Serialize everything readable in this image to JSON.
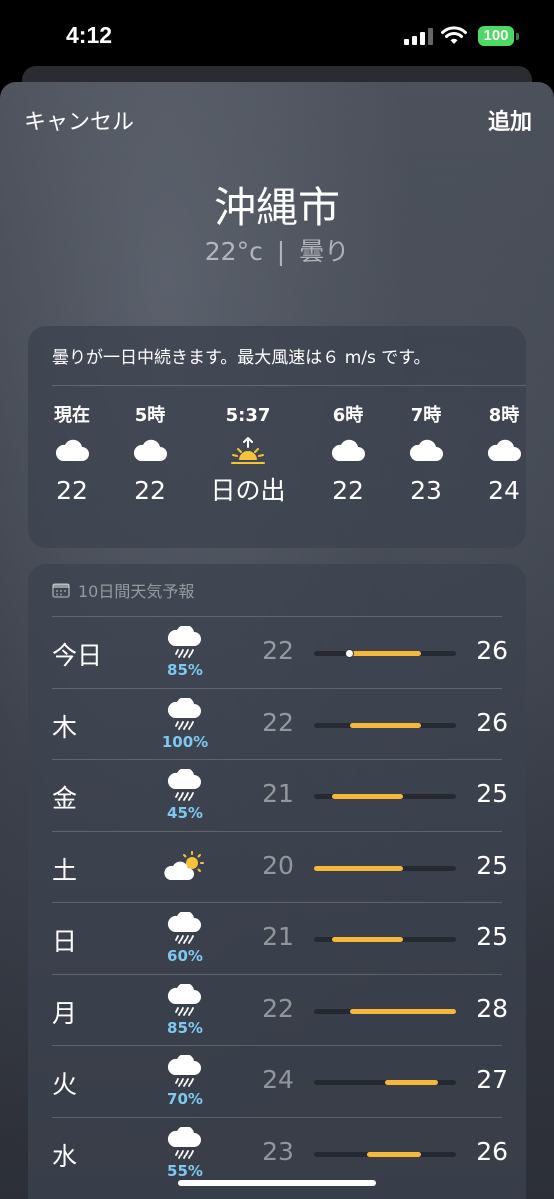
{
  "status": {
    "time": "4:12",
    "battery": "100"
  },
  "nav": {
    "cancel": "キャンセル",
    "add": "追加"
  },
  "location": {
    "city": "沖縄市",
    "temp": "22°c",
    "separator": "|",
    "condition": "曇り"
  },
  "hourly": {
    "summary": "曇りが一日中続きます。最大風速は６ m/s です。",
    "items": [
      {
        "label": "現在",
        "icon": "cloud-icon",
        "temp": "22"
      },
      {
        "label": "5時",
        "icon": "cloud-icon",
        "temp": "22"
      },
      {
        "label": "5:37",
        "icon": "sunrise-icon",
        "temp": "日の出"
      },
      {
        "label": "6時",
        "icon": "cloud-icon",
        "temp": "22"
      },
      {
        "label": "7時",
        "icon": "cloud-icon",
        "temp": "23"
      },
      {
        "label": "8時",
        "icon": "cloud-icon",
        "temp": "24"
      }
    ]
  },
  "forecast": {
    "title": "10日間天気予報",
    "range_min": 20,
    "range_max": 28,
    "days": [
      {
        "day": "今日",
        "icon": "rain-cloud-icon",
        "precip": "85%",
        "low": "22",
        "high": "26",
        "current": 22
      },
      {
        "day": "木",
        "icon": "rain-cloud-icon",
        "precip": "100%",
        "low": "22",
        "high": "26"
      },
      {
        "day": "金",
        "icon": "rain-cloud-icon",
        "precip": "45%",
        "low": "21",
        "high": "25"
      },
      {
        "day": "土",
        "icon": "partly-sunny-icon",
        "precip": "",
        "low": "20",
        "high": "25"
      },
      {
        "day": "日",
        "icon": "rain-cloud-icon",
        "precip": "60%",
        "low": "21",
        "high": "25"
      },
      {
        "day": "月",
        "icon": "rain-cloud-icon",
        "precip": "85%",
        "low": "22",
        "high": "28"
      },
      {
        "day": "火",
        "icon": "rain-cloud-icon",
        "precip": "70%",
        "low": "24",
        "high": "27"
      },
      {
        "day": "水",
        "icon": "rain-cloud-icon",
        "precip": "55%",
        "low": "23",
        "high": "26"
      }
    ]
  },
  "colors": {
    "bar": "#f4b93a",
    "precip": "#7fc8f0",
    "battery": "#4cd964"
  }
}
